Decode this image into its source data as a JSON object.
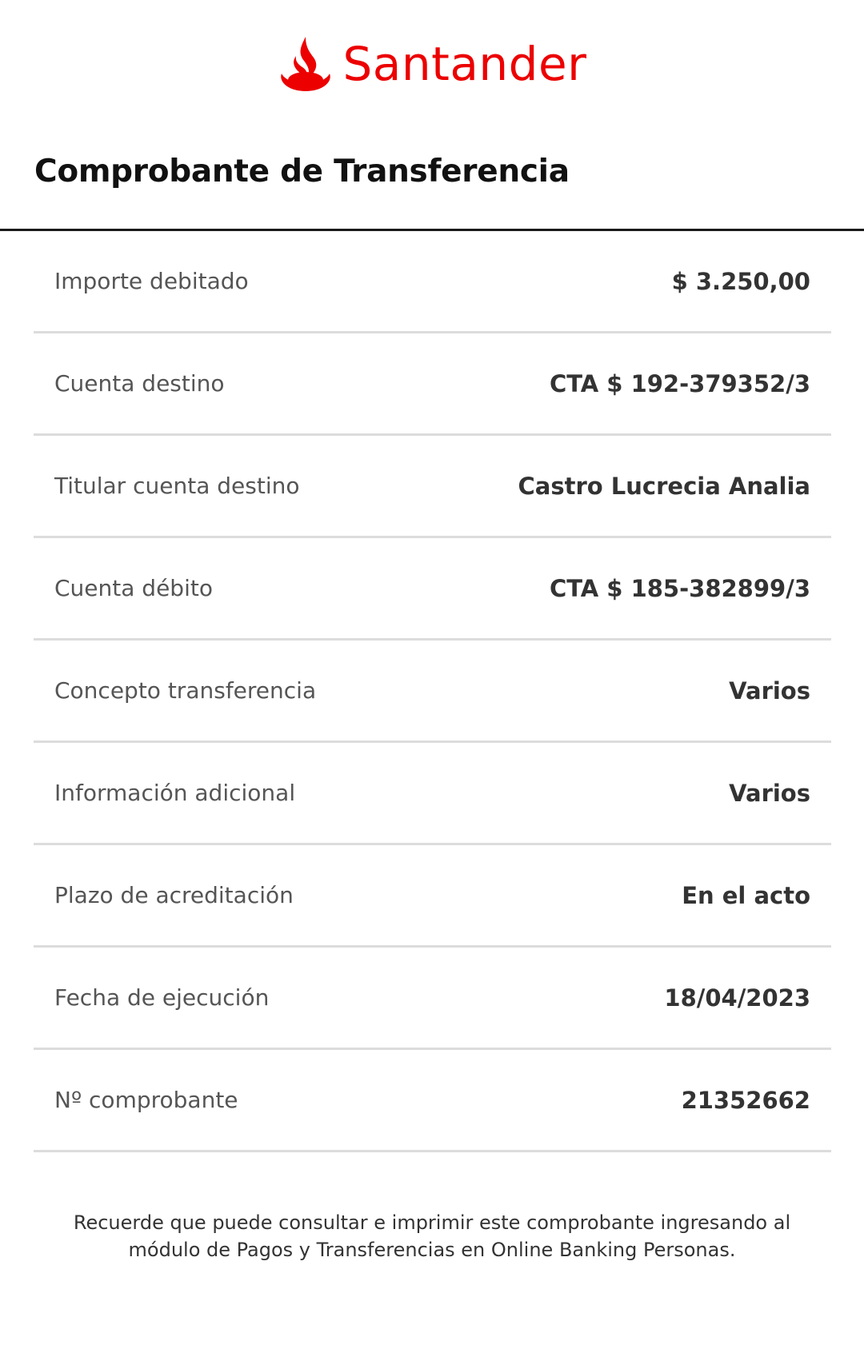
{
  "brand": {
    "name": "Santander",
    "color": "#ec0000",
    "icon": "santander-flame-icon"
  },
  "page": {
    "title": "Comprobante de Transferencia"
  },
  "details": [
    {
      "label": "Importe debitado",
      "value": "$ 3.250,00"
    },
    {
      "label": "Cuenta destino",
      "value": "CTA $ 192-379352/3"
    },
    {
      "label": "Titular cuenta destino",
      "value": "Castro Lucrecia Analia"
    },
    {
      "label": "Cuenta débito",
      "value": "CTA $ 185-382899/3"
    },
    {
      "label": "Concepto transferencia",
      "value": "Varios"
    },
    {
      "label": "Información adicional",
      "value": "Varios"
    },
    {
      "label": "Plazo de acreditación",
      "value": "En el acto"
    },
    {
      "label": "Fecha de ejecución",
      "value": "18/04/2023"
    },
    {
      "label": "Nº comprobante",
      "value": "21352662"
    }
  ],
  "footer": {
    "line1": "Recuerde que puede consultar e imprimir este comprobante ingresando al",
    "line2": "módulo de Pagos y Transferencias en Online Banking Personas."
  }
}
